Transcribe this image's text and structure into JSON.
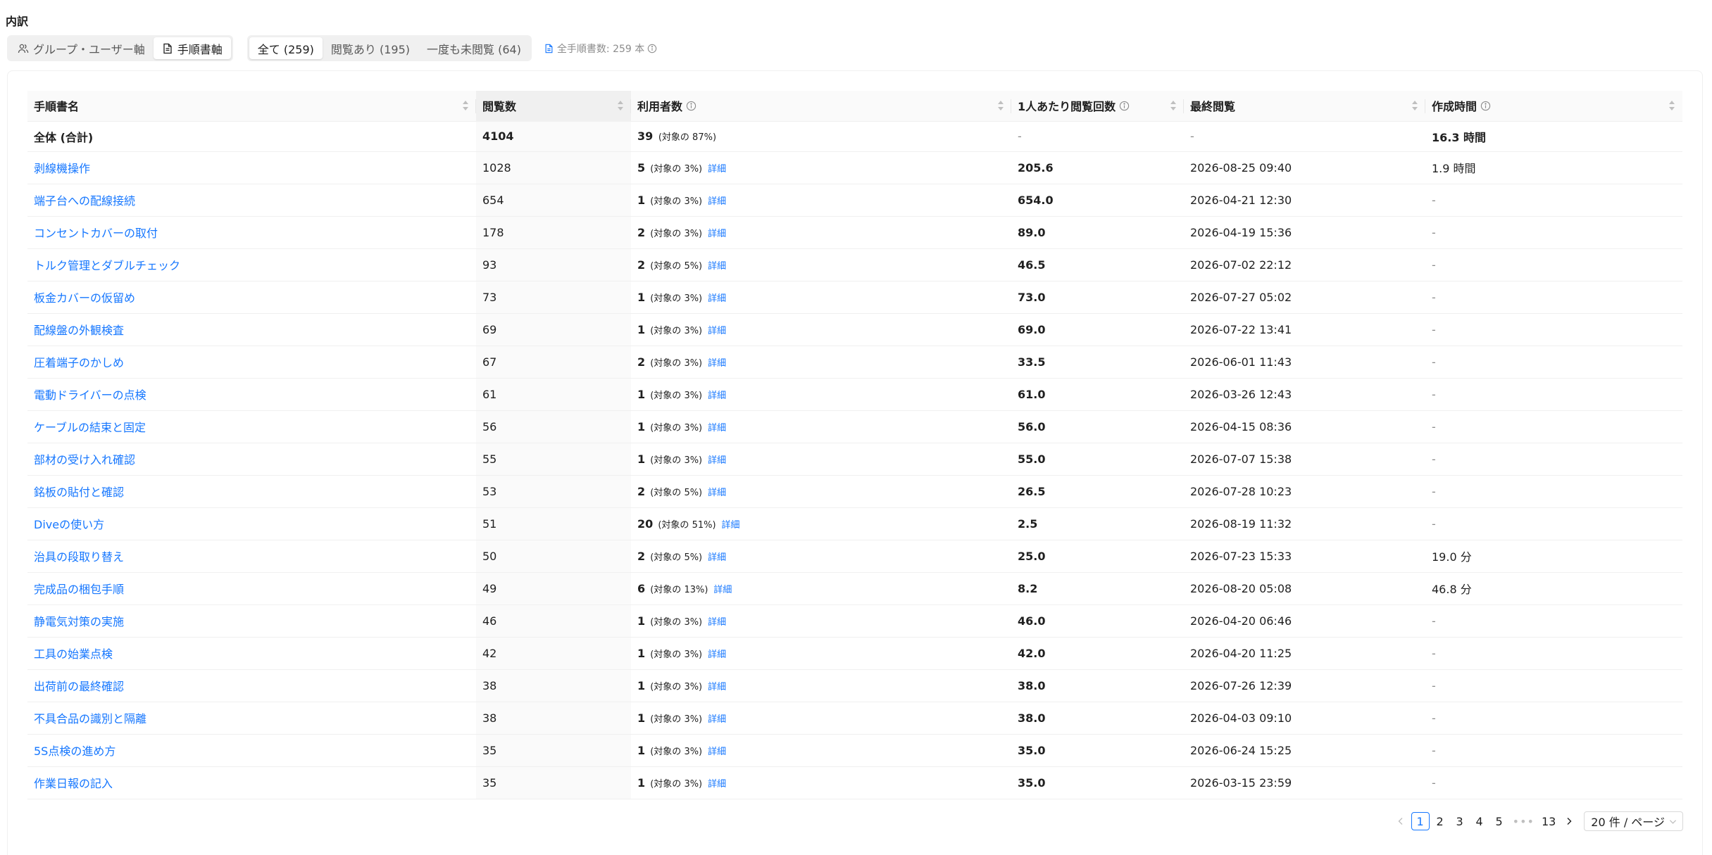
{
  "section_title": "内訳",
  "axis_toggle": [
    {
      "label": "グループ・ユーザー軸",
      "icon": "user-group-icon",
      "active": false
    },
    {
      "label": "手順書軸",
      "icon": "document-icon",
      "active": true
    }
  ],
  "filter_tabs": [
    {
      "label": "全て (259)",
      "active": true
    },
    {
      "label": "閲覧あり (195)",
      "active": false
    },
    {
      "label": "一度も未閲覧 (64)",
      "active": false
    }
  ],
  "total_note": "全手順書数: 259 本",
  "columns": [
    {
      "label": "手順書名",
      "info": false
    },
    {
      "label": "閲覧数",
      "info": false
    },
    {
      "label": "利用者数",
      "info": true
    },
    {
      "label": "1人あたり閲覧回数",
      "info": true
    },
    {
      "label": "最終閲覧",
      "info": false
    },
    {
      "label": "作成時間",
      "info": true
    }
  ],
  "total_row": {
    "name": "全体 (合計)",
    "views": "4104",
    "users": "39",
    "users_sub": "(対象の 87%)",
    "per_user": "-",
    "last_viewed": "-",
    "creation_time": "16.3 時間"
  },
  "detail_label": "詳細",
  "rows": [
    {
      "name": "剥線機操作",
      "views": "1028",
      "users": "5",
      "users_sub": "(対象の 3%)",
      "per_user": "205.6",
      "last_viewed": "2026-08-25 09:40",
      "creation_time": "1.9 時間"
    },
    {
      "name": "端子台への配線接続",
      "views": "654",
      "users": "1",
      "users_sub": "(対象の 3%)",
      "per_user": "654.0",
      "last_viewed": "2026-04-21 12:30",
      "creation_time": "-"
    },
    {
      "name": "コンセントカバーの取付",
      "views": "178",
      "users": "2",
      "users_sub": "(対象の 3%)",
      "per_user": "89.0",
      "last_viewed": "2026-04-19 15:36",
      "creation_time": "-"
    },
    {
      "name": "トルク管理とダブルチェック",
      "views": "93",
      "users": "2",
      "users_sub": "(対象の 5%)",
      "per_user": "46.5",
      "last_viewed": "2026-07-02 22:12",
      "creation_time": "-"
    },
    {
      "name": "板金カバーの仮留め",
      "views": "73",
      "users": "1",
      "users_sub": "(対象の 3%)",
      "per_user": "73.0",
      "last_viewed": "2026-07-27 05:02",
      "creation_time": "-"
    },
    {
      "name": "配線盤の外観検査",
      "views": "69",
      "users": "1",
      "users_sub": "(対象の 3%)",
      "per_user": "69.0",
      "last_viewed": "2026-07-22 13:41",
      "creation_time": "-"
    },
    {
      "name": "圧着端子のかしめ",
      "views": "67",
      "users": "2",
      "users_sub": "(対象の 3%)",
      "per_user": "33.5",
      "last_viewed": "2026-06-01 11:43",
      "creation_time": "-"
    },
    {
      "name": "電動ドライバーの点検",
      "views": "61",
      "users": "1",
      "users_sub": "(対象の 3%)",
      "per_user": "61.0",
      "last_viewed": "2026-03-26 12:43",
      "creation_time": "-"
    },
    {
      "name": "ケーブルの結束と固定",
      "views": "56",
      "users": "1",
      "users_sub": "(対象の 3%)",
      "per_user": "56.0",
      "last_viewed": "2026-04-15 08:36",
      "creation_time": "-"
    },
    {
      "name": "部材の受け入れ確認",
      "views": "55",
      "users": "1",
      "users_sub": "(対象の 3%)",
      "per_user": "55.0",
      "last_viewed": "2026-07-07 15:38",
      "creation_time": "-"
    },
    {
      "name": "銘板の貼付と確認",
      "views": "53",
      "users": "2",
      "users_sub": "(対象の 5%)",
      "per_user": "26.5",
      "last_viewed": "2026-07-28 10:23",
      "creation_time": "-"
    },
    {
      "name": "Diveの使い方",
      "views": "51",
      "users": "20",
      "users_sub": "(対象の 51%)",
      "per_user": "2.5",
      "last_viewed": "2026-08-19 11:32",
      "creation_time": "-"
    },
    {
      "name": "治具の段取り替え",
      "views": "50",
      "users": "2",
      "users_sub": "(対象の 5%)",
      "per_user": "25.0",
      "last_viewed": "2026-07-23 15:33",
      "creation_time": "19.0 分"
    },
    {
      "name": "完成品の梱包手順",
      "views": "49",
      "users": "6",
      "users_sub": "(対象の 13%)",
      "per_user": "8.2",
      "last_viewed": "2026-08-20 05:08",
      "creation_time": "46.8 分"
    },
    {
      "name": "静電気対策の実施",
      "views": "46",
      "users": "1",
      "users_sub": "(対象の 3%)",
      "per_user": "46.0",
      "last_viewed": "2026-04-20 06:46",
      "creation_time": "-"
    },
    {
      "name": "工具の始業点検",
      "views": "42",
      "users": "1",
      "users_sub": "(対象の 3%)",
      "per_user": "42.0",
      "last_viewed": "2026-04-20 11:25",
      "creation_time": "-"
    },
    {
      "name": "出荷前の最終確認",
      "views": "38",
      "users": "1",
      "users_sub": "(対象の 3%)",
      "per_user": "38.0",
      "last_viewed": "2026-07-26 12:39",
      "creation_time": "-"
    },
    {
      "name": "不具合品の識別と隔離",
      "views": "38",
      "users": "1",
      "users_sub": "(対象の 3%)",
      "per_user": "38.0",
      "last_viewed": "2026-04-03 09:10",
      "creation_time": "-"
    },
    {
      "name": "5S点検の進め方",
      "views": "35",
      "users": "1",
      "users_sub": "(対象の 3%)",
      "per_user": "35.0",
      "last_viewed": "2026-06-24 15:25",
      "creation_time": "-"
    },
    {
      "name": "作業日報の記入",
      "views": "35",
      "users": "1",
      "users_sub": "(対象の 3%)",
      "per_user": "35.0",
      "last_viewed": "2026-03-15 23:59",
      "creation_time": "-"
    }
  ],
  "pagination": {
    "pages": [
      "1",
      "2",
      "3",
      "4",
      "5"
    ],
    "current": "1",
    "ellipsis": "•••",
    "last_page": "13",
    "page_size_label": "20 件 / ページ"
  },
  "colors": {
    "link": "#1677ff",
    "muted": "#8c8c8c",
    "header_bg": "#fafafa"
  }
}
